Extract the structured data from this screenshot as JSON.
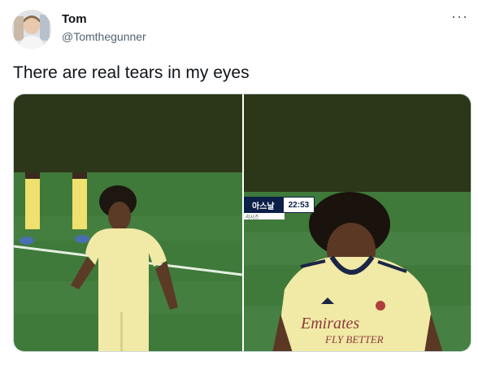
{
  "tweet": {
    "display_name": "Tom",
    "handle": "@Tomthegunner",
    "text": "There are real tears in my eyes",
    "more_icon": "more-icon"
  },
  "media": {
    "overlay": {
      "team_label": "아스날",
      "clock": "22:53",
      "sub_label": "리시즈"
    },
    "shirt_text_line1": "Emirates",
    "shirt_text_line2": "FLY BETTER"
  },
  "colors": {
    "pitch": "#3f7a3a",
    "sky": "#2c3618",
    "kit": "#f1e9a6",
    "text_primary": "#0f1419",
    "text_secondary": "#536471"
  }
}
